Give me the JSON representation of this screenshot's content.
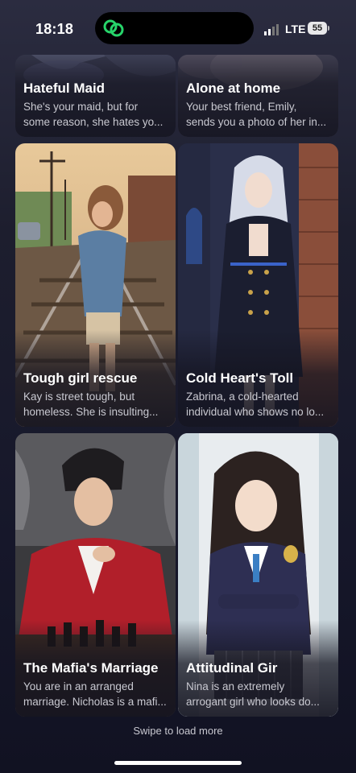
{
  "status": {
    "time": "18:18",
    "network": "LTE",
    "battery": "55"
  },
  "cards": [
    {
      "title": "Hateful Maid",
      "desc": [
        "She's your maid, but for",
        "some reason, she hates yo..."
      ]
    },
    {
      "title": "Alone at home",
      "desc": [
        "Your best friend, Emily,",
        "sends you a photo of her in..."
      ]
    },
    {
      "title": "Tough girl rescue",
      "desc": [
        "Kay is street tough, but",
        "homeless. She is insulting..."
      ]
    },
    {
      "title": "Cold Heart's Toll",
      "desc": [
        "Zabrina, a cold-hearted",
        "individual who shows no lo..."
      ]
    },
    {
      "title": "The Mafia's Marriage",
      "desc": [
        "You are in an arranged",
        "marriage. Nicholas is a mafi..."
      ]
    },
    {
      "title": "Attitudinal Gir",
      "desc": [
        "Nina is an extremely",
        "arrogant girl who looks do..."
      ]
    }
  ],
  "footer": {
    "hint": "Swipe to load more"
  },
  "colors": {
    "background": "#1d1e2e",
    "card": "#262839",
    "description": "#c9c9d1",
    "app_icon": "#27d46a"
  }
}
